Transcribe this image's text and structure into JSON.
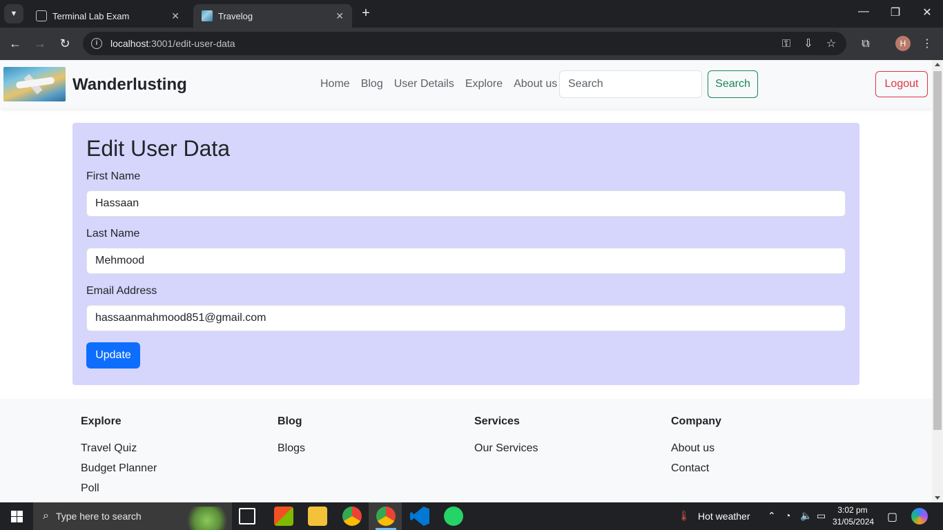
{
  "browser": {
    "tabs": [
      {
        "title": "Terminal Lab Exam",
        "active": false
      },
      {
        "title": "Travelog",
        "active": true
      }
    ],
    "url_host": "localhost",
    "url_path": ":3001/edit-user-data",
    "profile_initial": "H"
  },
  "navbar": {
    "brand": "Wanderlusting",
    "links": [
      "Home",
      "Blog",
      "User Details",
      "Explore",
      "About us"
    ],
    "search_placeholder": "Search",
    "search_button": "Search",
    "logout_button": "Logout"
  },
  "form": {
    "title": "Edit User Data",
    "first_name_label": "First Name",
    "first_name_value": "Hassaan",
    "last_name_label": "Last Name",
    "last_name_value": "Mehmood",
    "email_label": "Email Address",
    "email_value": "hassaanmahmood851@gmail.com",
    "submit_label": "Update"
  },
  "footer": {
    "columns": [
      {
        "heading": "Explore",
        "links": [
          "Travel Quiz",
          "Budget Planner",
          "Poll"
        ]
      },
      {
        "heading": "Blog",
        "links": [
          "Blogs"
        ]
      },
      {
        "heading": "Services",
        "links": [
          "Our Services"
        ]
      },
      {
        "heading": "Company",
        "links": [
          "About us",
          "Contact"
        ]
      }
    ]
  },
  "taskbar": {
    "search_placeholder": "Type here to search",
    "weather": "Hot weather",
    "time": "3:02 pm",
    "date": "31/05/2024"
  },
  "colors": {
    "card_bg": "#d6d5fb",
    "primary": "#0d6efd",
    "success": "#198754",
    "danger": "#dc3545"
  }
}
